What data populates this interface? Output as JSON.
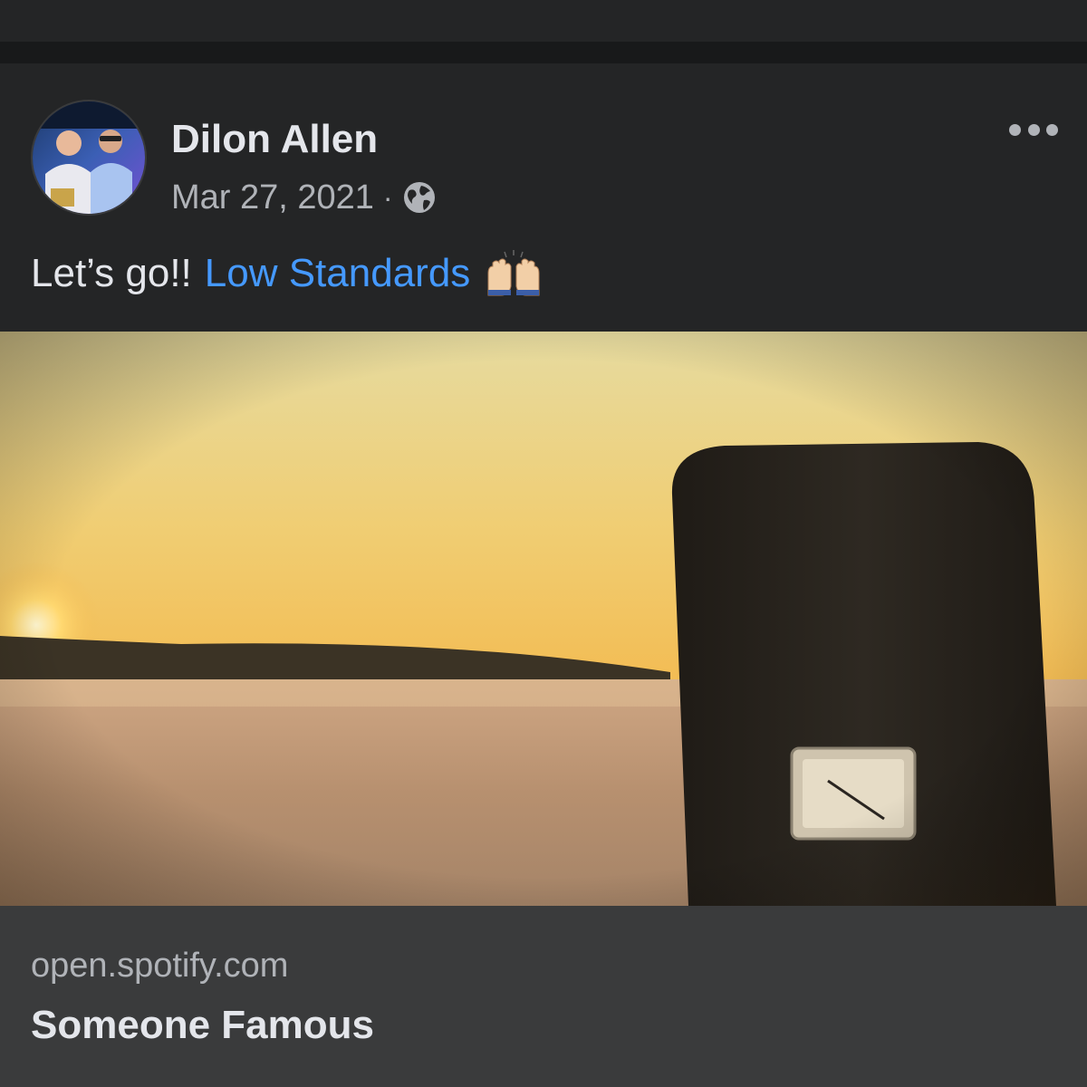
{
  "post": {
    "author": "Dilon Allen",
    "date": "Mar 27, 2021",
    "separator": "·",
    "audience_icon": "globe-icon",
    "text_prefix": "Let’s go!!",
    "mention": "Low Standards",
    "emoji": "raising-hands-emoji",
    "more_icon": "more-options-icon"
  },
  "link_preview": {
    "domain": "open.spotify.com",
    "title": "Someone Famous"
  },
  "colors": {
    "background": "#242526",
    "divider": "#18191a",
    "footer": "#3a3b3c",
    "text_primary": "#e4e6eb",
    "text_secondary": "#b0b3b8",
    "link": "#4599ff"
  }
}
